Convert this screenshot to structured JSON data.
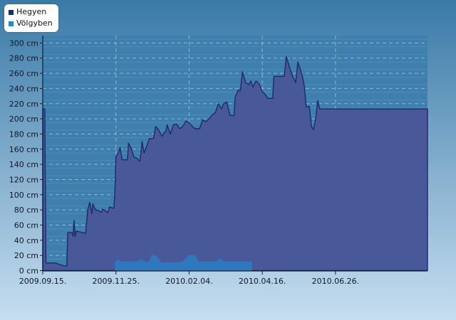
{
  "colors": {
    "background_top": "#3a7aa7",
    "background_bottom": "#c6def0",
    "plot_background": "#3e7fae",
    "grid_line": "#a9c7de",
    "axis_line": "#0d1d3a",
    "hegyen_fill": "#485898",
    "hegyen_stroke": "#1c2a6c",
    "volgyben_fill": "#2f78be"
  },
  "legend": {
    "items": [
      {
        "label": "Hegyen",
        "color": "#1c2a6c"
      },
      {
        "label": "Völgyben",
        "color": "#2b86c8"
      }
    ]
  },
  "chart_data": {
    "type": "area",
    "title": "",
    "xlabel": "",
    "ylabel": "",
    "unit": "cm",
    "y_tick_labels": [
      "0 cm",
      "20 cm",
      "40 cm",
      "60 cm",
      "80 cm",
      "100 cm",
      "120 cm",
      "140 cm",
      "160 cm",
      "180 cm",
      "200 cm",
      "220 cm",
      "240 cm",
      "260 cm",
      "280 cm",
      "300 cm"
    ],
    "ylim": [
      0,
      310
    ],
    "x_tick_labels": [
      "2009.09.15.",
      "2009.11.25.",
      "2010.02.04.",
      "2010.04.16.",
      "2010.06.26."
    ],
    "xlim": [
      "2009-09-15",
      "2010-09-18"
    ],
    "grid": true,
    "legend_position": "top-left",
    "series": [
      {
        "name": "Hegyen",
        "points": [
          [
            "2009-09-15",
            0
          ],
          [
            "2009-09-15",
            213
          ],
          [
            "2009-09-17",
            213
          ],
          [
            "2009-09-18",
            10
          ],
          [
            "2009-09-27",
            10
          ],
          [
            "2009-10-01",
            8
          ],
          [
            "2009-10-06",
            6
          ],
          [
            "2009-10-08",
            6
          ],
          [
            "2009-10-09",
            50
          ],
          [
            "2009-10-13",
            50
          ],
          [
            "2009-10-14",
            45
          ],
          [
            "2009-10-15",
            66
          ],
          [
            "2009-10-16",
            45
          ],
          [
            "2009-10-17",
            52
          ],
          [
            "2009-10-23",
            50
          ],
          [
            "2009-10-26",
            49
          ],
          [
            "2009-10-28",
            80
          ],
          [
            "2009-10-30",
            90
          ],
          [
            "2009-11-01",
            75
          ],
          [
            "2009-11-02",
            88
          ],
          [
            "2009-11-04",
            81
          ],
          [
            "2009-11-07",
            79
          ],
          [
            "2009-11-10",
            77
          ],
          [
            "2009-11-11",
            81
          ],
          [
            "2009-11-14",
            79
          ],
          [
            "2009-11-16",
            76
          ],
          [
            "2009-11-18",
            84
          ],
          [
            "2009-11-22",
            82
          ],
          [
            "2009-11-23",
            104
          ],
          [
            "2009-11-24",
            150
          ],
          [
            "2009-11-26",
            154
          ],
          [
            "2009-11-28",
            162
          ],
          [
            "2009-11-30",
            146
          ],
          [
            "2009-12-05",
            146
          ],
          [
            "2009-12-06",
            168
          ],
          [
            "2009-12-09",
            160
          ],
          [
            "2009-12-11",
            150
          ],
          [
            "2009-12-14",
            148
          ],
          [
            "2009-12-17",
            144
          ],
          [
            "2009-12-19",
            170
          ],
          [
            "2009-12-21",
            155
          ],
          [
            "2009-12-24",
            166
          ],
          [
            "2009-12-26",
            174
          ],
          [
            "2009-12-30",
            174
          ],
          [
            "2010-01-01",
            190
          ],
          [
            "2010-01-04",
            185
          ],
          [
            "2010-01-07",
            177
          ],
          [
            "2010-01-11",
            185
          ],
          [
            "2010-01-12",
            192
          ],
          [
            "2010-01-15",
            180
          ],
          [
            "2010-01-18",
            192
          ],
          [
            "2010-01-21",
            193
          ],
          [
            "2010-01-24",
            187
          ],
          [
            "2010-01-27",
            190
          ],
          [
            "2010-01-30",
            197
          ],
          [
            "2010-02-02",
            195
          ],
          [
            "2010-02-05",
            190
          ],
          [
            "2010-02-08",
            187
          ],
          [
            "2010-02-12",
            187
          ],
          [
            "2010-02-15",
            199
          ],
          [
            "2010-02-18",
            196
          ],
          [
            "2010-02-21",
            200
          ],
          [
            "2010-02-24",
            205
          ],
          [
            "2010-02-27",
            208
          ],
          [
            "2010-03-02",
            220
          ],
          [
            "2010-03-05",
            213
          ],
          [
            "2010-03-07",
            220
          ],
          [
            "2010-03-10",
            222
          ],
          [
            "2010-03-13",
            205
          ],
          [
            "2010-03-17",
            204
          ],
          [
            "2010-03-18",
            228
          ],
          [
            "2010-03-21",
            238
          ],
          [
            "2010-03-23",
            237
          ],
          [
            "2010-03-25",
            262
          ],
          [
            "2010-03-28",
            248
          ],
          [
            "2010-03-31",
            245
          ],
          [
            "2010-04-02",
            250
          ],
          [
            "2010-04-04",
            242
          ],
          [
            "2010-04-07",
            250
          ],
          [
            "2010-04-10",
            246
          ],
          [
            "2010-04-13",
            236
          ],
          [
            "2010-04-16",
            232
          ],
          [
            "2010-04-18",
            227
          ],
          [
            "2010-04-23",
            227
          ],
          [
            "2010-04-24",
            256
          ],
          [
            "2010-05-04",
            256
          ],
          [
            "2010-05-06",
            282
          ],
          [
            "2010-05-09",
            268
          ],
          [
            "2010-05-12",
            256
          ],
          [
            "2010-05-15",
            248
          ],
          [
            "2010-05-17",
            275
          ],
          [
            "2010-05-21",
            258
          ],
          [
            "2010-05-23",
            245
          ],
          [
            "2010-05-25",
            216
          ],
          [
            "2010-05-28",
            216
          ],
          [
            "2010-05-30",
            190
          ],
          [
            "2010-06-01",
            186
          ],
          [
            "2010-06-03",
            200
          ],
          [
            "2010-06-05",
            224
          ],
          [
            "2010-06-07",
            213
          ],
          [
            "2010-09-18",
            213
          ],
          [
            "2010-09-18",
            0
          ]
        ]
      },
      {
        "name": "Völgyben",
        "points": [
          [
            "2009-11-23",
            0
          ],
          [
            "2009-11-23",
            10
          ],
          [
            "2009-11-26",
            15
          ],
          [
            "2009-11-28",
            12
          ],
          [
            "2009-12-14",
            12
          ],
          [
            "2009-12-18",
            15
          ],
          [
            "2009-12-23",
            11
          ],
          [
            "2009-12-26",
            13
          ],
          [
            "2009-12-28",
            21
          ],
          [
            "2010-01-02",
            19
          ],
          [
            "2010-01-06",
            11
          ],
          [
            "2010-01-25",
            11
          ],
          [
            "2010-01-29",
            15
          ],
          [
            "2010-02-02",
            20
          ],
          [
            "2010-02-05",
            21
          ],
          [
            "2010-02-08",
            20
          ],
          [
            "2010-02-11",
            12
          ],
          [
            "2010-02-28",
            12
          ],
          [
            "2010-03-04",
            16
          ],
          [
            "2010-03-07",
            12
          ],
          [
            "2010-04-03",
            12
          ],
          [
            "2010-04-03",
            0
          ]
        ]
      }
    ]
  }
}
